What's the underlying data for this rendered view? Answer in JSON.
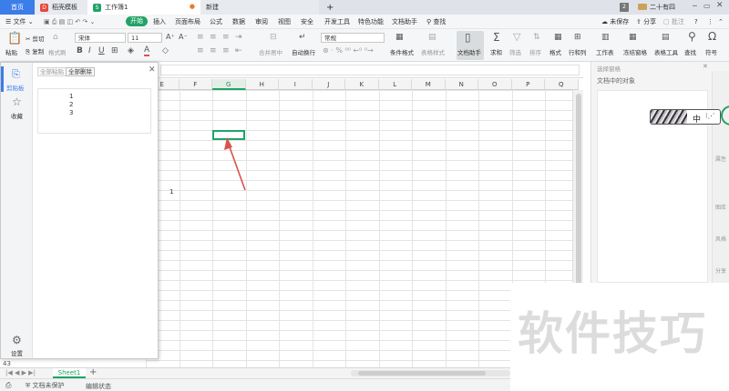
{
  "tabs": {
    "home": "首页",
    "file_tab": "稻壳模板",
    "active_tab": "工作簿1",
    "new_tab": "新建",
    "add_tab": "+",
    "page_count": "2",
    "user_name": "二十有四"
  },
  "menu": {
    "file": "文件",
    "start": "开始",
    "insert": "插入",
    "page_layout": "页面布局",
    "formula": "公式",
    "data": "数据",
    "review": "审阅",
    "view": "视图",
    "security": "安全",
    "dev_tools": "开发工具",
    "special": "特色功能",
    "doc_assistant": "文档助手",
    "search": "查找",
    "unsaved": "未保存",
    "share": "分享",
    "annotate": "批注",
    "help": "?"
  },
  "ribbon": {
    "paste": "粘贴",
    "cut": "剪切",
    "copy": "复制",
    "format_painter": "格式刷",
    "font_name": "宋体",
    "font_size": "11",
    "merge_center": "合并居中",
    "wrap": "自动换行",
    "number_format": "常规",
    "cond_format": "条件格式",
    "table_style": "表格样式",
    "doc_assistant": "文档助手",
    "sum": "求和",
    "filter": "筛选",
    "sort": "排序",
    "format": "格式",
    "rows_cols": "行和列",
    "worksheet": "工作表",
    "freeze": "冻结窗格",
    "table_tools": "表格工具",
    "find": "查找",
    "symbol": "符号"
  },
  "columns": [
    "E",
    "F",
    "G",
    "H",
    "I",
    "J",
    "K",
    "L",
    "M",
    "N",
    "O",
    "P",
    "Q"
  ],
  "selected_column": "G",
  "cell_value": "1",
  "clipboard": {
    "side_clipboard": "剪贴板",
    "side_favorites": "收藏",
    "side_settings": "设置",
    "paste_all": "全部粘贴",
    "clear_all": "全部删除",
    "item_lines": [
      "1",
      "2",
      "3"
    ],
    "row_number": "43"
  },
  "right_panel": {
    "title": "选择窗格",
    "subtitle": "文档中的对象",
    "float_label": "中"
  },
  "right_side": {
    "attributes": "属性",
    "image": "图库",
    "style": "风格",
    "share": "分享"
  },
  "sheet": {
    "name": "Sheet1",
    "add": "+"
  },
  "status": {
    "doc_unprotected": "文档未保护",
    "edit_state": "编辑状态"
  },
  "watermark": "软件技巧",
  "colors": {
    "accent": "#21a366",
    "home_tab": "#3b7de9",
    "arrow": "#d9534f"
  }
}
